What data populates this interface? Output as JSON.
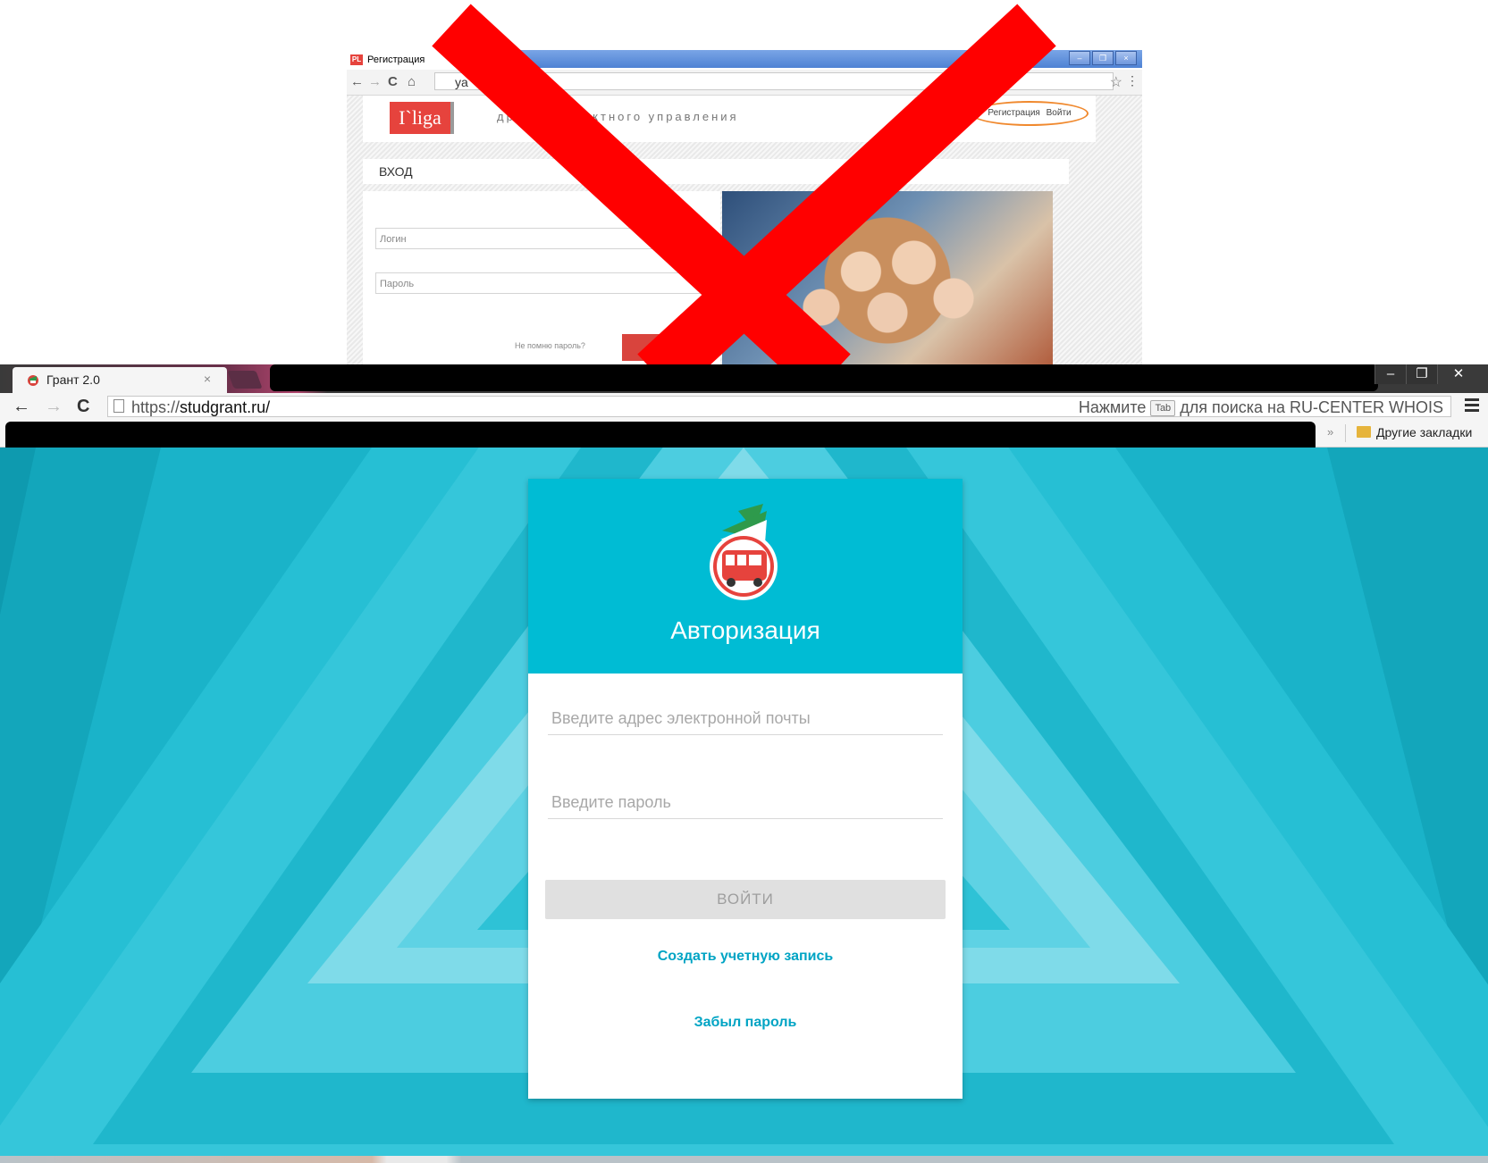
{
  "old_site": {
    "window_title": "Регистрация",
    "favicon_text": "PL",
    "address_text": "ya",
    "logo": "I`liga",
    "slogan": "др         ема проектного управления",
    "register_link": "Регистрация",
    "login_link": "Войти",
    "section_title": "ВХОД",
    "login_placeholder": "Логин",
    "password_placeholder": "Пароль",
    "forgot_link": "Не помню пароль?"
  },
  "browser": {
    "tab_title": "Грант 2.0",
    "tab_close": "×",
    "url_prefix": "https://",
    "url_domain": "studgrant.ru/",
    "omnibox_hint_before": "Нажмите",
    "omnibox_hint_key": "Tab",
    "omnibox_hint_after": "для поиска на RU-CENTER WHOIS",
    "other_bookmarks": "Другие закладки",
    "bookmarks_overflow": "»"
  },
  "login_card": {
    "title": "Авторизация",
    "email_placeholder": "Введите адрес электронной почты",
    "password_placeholder": "Введите пароль",
    "submit_label": "ВОЙТИ",
    "create_account_link": "Создать учетную запись",
    "forgot_password_link": "Забыл пароль"
  },
  "colors": {
    "accent": "#00bcd4",
    "link": "#00a4c4",
    "cross_out": "#ff0000",
    "highlight_ellipse": "#f0892e",
    "old_logo": "#e6433d"
  },
  "icons": {
    "back": "arrow-left-icon",
    "forward": "arrow-right-icon",
    "reload": "reload-icon",
    "home": "home-icon",
    "star": "bookmark-star-icon",
    "menu": "hamburger-menu-icon",
    "folder": "folder-icon",
    "logo": "bus-flag-logo-icon"
  }
}
